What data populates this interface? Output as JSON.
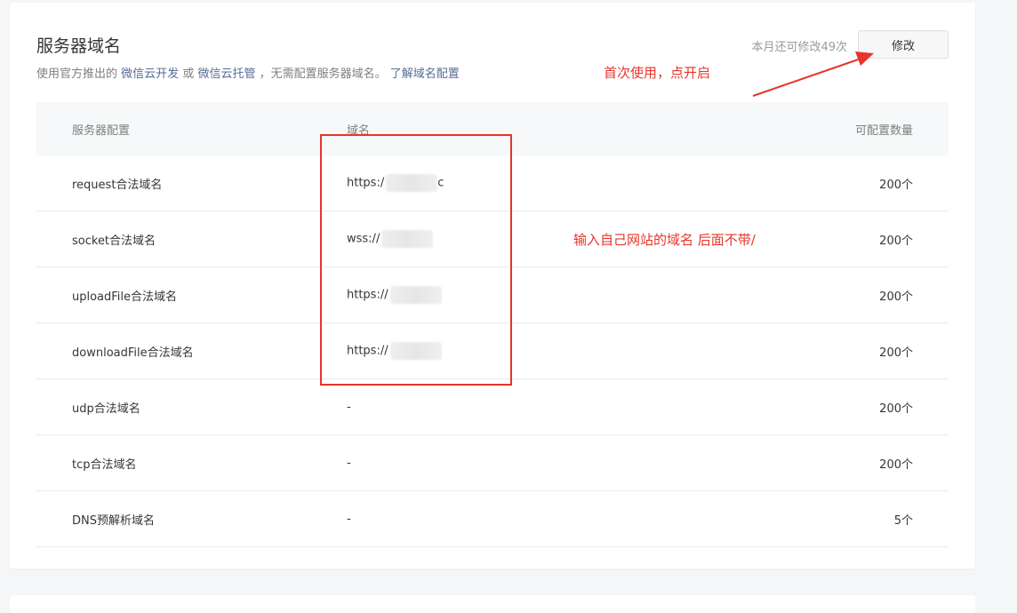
{
  "header": {
    "title": "服务器域名",
    "subtitle_prefix": "使用官方推出的",
    "link_cloud_dev": "微信云开发",
    "subtitle_or": "或",
    "link_cloud_host": "微信云托管",
    "subtitle_suffix": "，无需配置服务器域名。",
    "link_learn": "了解域名配置",
    "quota_text": "本月还可修改49次",
    "modify_label": "修改"
  },
  "annotations": {
    "first_use": "首次使用，点开启",
    "domain_hint": "输入自己网站的域名  后面不带/"
  },
  "table": {
    "headers": [
      "服务器配置",
      "域名",
      "可配置数量"
    ],
    "rows": [
      {
        "name": "request合法域名",
        "domain": "https:/",
        "domain_tail": "c",
        "count": "200个"
      },
      {
        "name": "socket合法域名",
        "domain": "wss://",
        "domain_tail": "",
        "count": "200个"
      },
      {
        "name": "uploadFile合法域名",
        "domain": "https://",
        "domain_tail": "",
        "count": "200个"
      },
      {
        "name": "downloadFile合法域名",
        "domain": "https://",
        "domain_tail": "",
        "count": "200个"
      },
      {
        "name": "udp合法域名",
        "domain": "-",
        "domain_tail": "",
        "count": "200个"
      },
      {
        "name": "tcp合法域名",
        "domain": "-",
        "domain_tail": "",
        "count": "200个"
      },
      {
        "name": "DNS预解析域名",
        "domain": "-",
        "domain_tail": "",
        "count": "5个"
      }
    ]
  },
  "colors": {
    "annotation": "#e8342b",
    "link": "#576b95"
  }
}
